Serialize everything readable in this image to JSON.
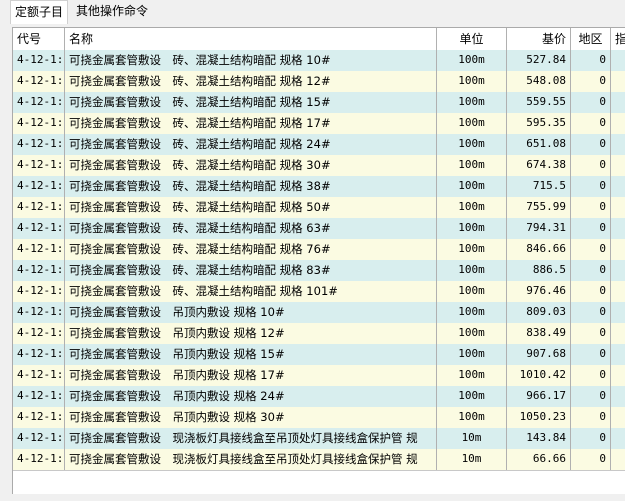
{
  "tabs": [
    "定额子目",
    "其他操作命令"
  ],
  "columns": [
    "代号",
    "名称",
    "单位",
    "基价",
    "地区",
    "指"
  ],
  "colors": {
    "row_a": "#d8eeee",
    "row_b": "#fbfbe2"
  },
  "rows": [
    {
      "code": "4-12-1:",
      "name": "可挠金属套管敷设　砖、混凝土结构暗配 规格 10#",
      "unit": "100m",
      "price": "527.84",
      "region": "0",
      "extra": ""
    },
    {
      "code": "4-12-1:",
      "name": "可挠金属套管敷设　砖、混凝土结构暗配 规格 12#",
      "unit": "100m",
      "price": "548.08",
      "region": "0",
      "extra": ""
    },
    {
      "code": "4-12-1:",
      "name": "可挠金属套管敷设　砖、混凝土结构暗配 规格 15#",
      "unit": "100m",
      "price": "559.55",
      "region": "0",
      "extra": ""
    },
    {
      "code": "4-12-1:",
      "name": "可挠金属套管敷设　砖、混凝土结构暗配 规格 17#",
      "unit": "100m",
      "price": "595.35",
      "region": "0",
      "extra": ""
    },
    {
      "code": "4-12-1:",
      "name": "可挠金属套管敷设　砖、混凝土结构暗配 规格 24#",
      "unit": "100m",
      "price": "651.08",
      "region": "0",
      "extra": ""
    },
    {
      "code": "4-12-1:",
      "name": "可挠金属套管敷设　砖、混凝土结构暗配 规格 30#",
      "unit": "100m",
      "price": "674.38",
      "region": "0",
      "extra": ""
    },
    {
      "code": "4-12-1:",
      "name": "可挠金属套管敷设　砖、混凝土结构暗配 规格 38#",
      "unit": "100m",
      "price": "715.5",
      "region": "0",
      "extra": ""
    },
    {
      "code": "4-12-1:",
      "name": "可挠金属套管敷设　砖、混凝土结构暗配 规格 50#",
      "unit": "100m",
      "price": "755.99",
      "region": "0",
      "extra": ""
    },
    {
      "code": "4-12-1:",
      "name": "可挠金属套管敷设　砖、混凝土结构暗配 规格 63#",
      "unit": "100m",
      "price": "794.31",
      "region": "0",
      "extra": ""
    },
    {
      "code": "4-12-1:",
      "name": "可挠金属套管敷设　砖、混凝土结构暗配 规格 76#",
      "unit": "100m",
      "price": "846.66",
      "region": "0",
      "extra": ""
    },
    {
      "code": "4-12-1:",
      "name": "可挠金属套管敷设　砖、混凝土结构暗配 规格 83#",
      "unit": "100m",
      "price": "886.5",
      "region": "0",
      "extra": ""
    },
    {
      "code": "4-12-1:",
      "name": "可挠金属套管敷设　砖、混凝土结构暗配 规格 101#",
      "unit": "100m",
      "price": "976.46",
      "region": "0",
      "extra": ""
    },
    {
      "code": "4-12-1:",
      "name": "可挠金属套管敷设　吊顶内敷设 规格 10#",
      "unit": "100m",
      "price": "809.03",
      "region": "0",
      "extra": ""
    },
    {
      "code": "4-12-1:",
      "name": "可挠金属套管敷设　吊顶内敷设 规格 12#",
      "unit": "100m",
      "price": "838.49",
      "region": "0",
      "extra": ""
    },
    {
      "code": "4-12-1:",
      "name": "可挠金属套管敷设　吊顶内敷设 规格 15#",
      "unit": "100m",
      "price": "907.68",
      "region": "0",
      "extra": ""
    },
    {
      "code": "4-12-1:",
      "name": "可挠金属套管敷设　吊顶内敷设 规格 17#",
      "unit": "100m",
      "price": "1010.42",
      "region": "0",
      "extra": ""
    },
    {
      "code": "4-12-1:",
      "name": "可挠金属套管敷设　吊顶内敷设 规格 24#",
      "unit": "100m",
      "price": "966.17",
      "region": "0",
      "extra": ""
    },
    {
      "code": "4-12-1:",
      "name": "可挠金属套管敷设　吊顶内敷设 规格 30#",
      "unit": "100m",
      "price": "1050.23",
      "region": "0",
      "extra": ""
    },
    {
      "code": "4-12-1:",
      "name": "可挠金属套管敷设　现浇板灯具接线盒至吊顶处灯具接线盒保护管 规",
      "unit": "10m",
      "price": "143.84",
      "region": "0",
      "extra": ""
    },
    {
      "code": "4-12-1:",
      "name": "可挠金属套管敷设　现浇板灯具接线盒至吊顶处灯具接线盒保护管 规",
      "unit": "10m",
      "price": "66.66",
      "region": "0",
      "extra": ""
    }
  ]
}
